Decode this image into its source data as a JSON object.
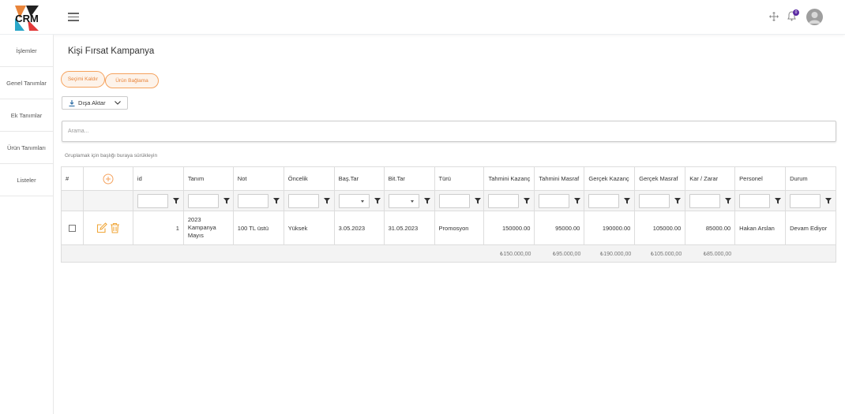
{
  "sidebar": {
    "items": [
      {
        "label": "İşlemler"
      },
      {
        "label": "Genel Tanımlar"
      },
      {
        "label": "Ek Tanımlar"
      },
      {
        "label": "Ürün Tanımları"
      },
      {
        "label": "Listeler"
      }
    ]
  },
  "header": {
    "logo_text": "CRM",
    "notification_count": "0"
  },
  "page": {
    "title": "Kişi Fırsat Kampanya",
    "buttons": {
      "clear_selection": "Seçimi Kaldır",
      "product_link": "Ürün Bağlama",
      "export": "Dışa Aktar"
    },
    "search_placeholder": "Arama...",
    "group_hint": "Gruplamak için başlığı buraya sürükleyin"
  },
  "grid": {
    "columns": [
      "#",
      "",
      "id",
      "Tanım",
      "Not",
      "Öncelik",
      "Baş.Tar",
      "Bit.Tar",
      "Türü",
      "Tahmini Kazanç",
      "Tahmini Masraf",
      "Gerçek Kazanç",
      "Gerçek Masraf",
      "Kar / Zarar",
      "Personel",
      "Durum"
    ],
    "row": {
      "id": "1",
      "tanim": "2023 Kampanya Mayıs",
      "not": "100 TL üstü",
      "oncelik": "Yüksek",
      "bas_tar": "3.05.2023",
      "bit_tar": "31.05.2023",
      "turu": "Promosyon",
      "tahmini_kazanc": "150000.00",
      "tahmini_masraf": "95000.00",
      "gercek_kazanc": "190000.00",
      "gercek_masraf": "105000.00",
      "kar_zarar": "85000.00",
      "personel": "Hakan Arslan",
      "durum": "Devam Ediyor"
    },
    "totals": {
      "tahmini_kazanc": "₺150.000,00",
      "tahmini_masraf": "₺95.000,00",
      "gercek_kazanc": "₺190.000,00",
      "gercek_masraf": "₺105.000,00",
      "kar_zarar": "₺85.000,00"
    }
  },
  "colors": {
    "accent": "#f5a25d",
    "badge": "#5b2aa3",
    "edit_icon": "#f0a73a",
    "delete_icon": "#f0a73a"
  },
  "icons": {
    "menu": "hamburger-icon",
    "move": "move-icon",
    "notifications": "bell-icon",
    "add": "plus-circle-icon",
    "filter": "funnel-icon",
    "edit": "edit-icon",
    "delete": "trash-icon",
    "export": "download-icon"
  }
}
